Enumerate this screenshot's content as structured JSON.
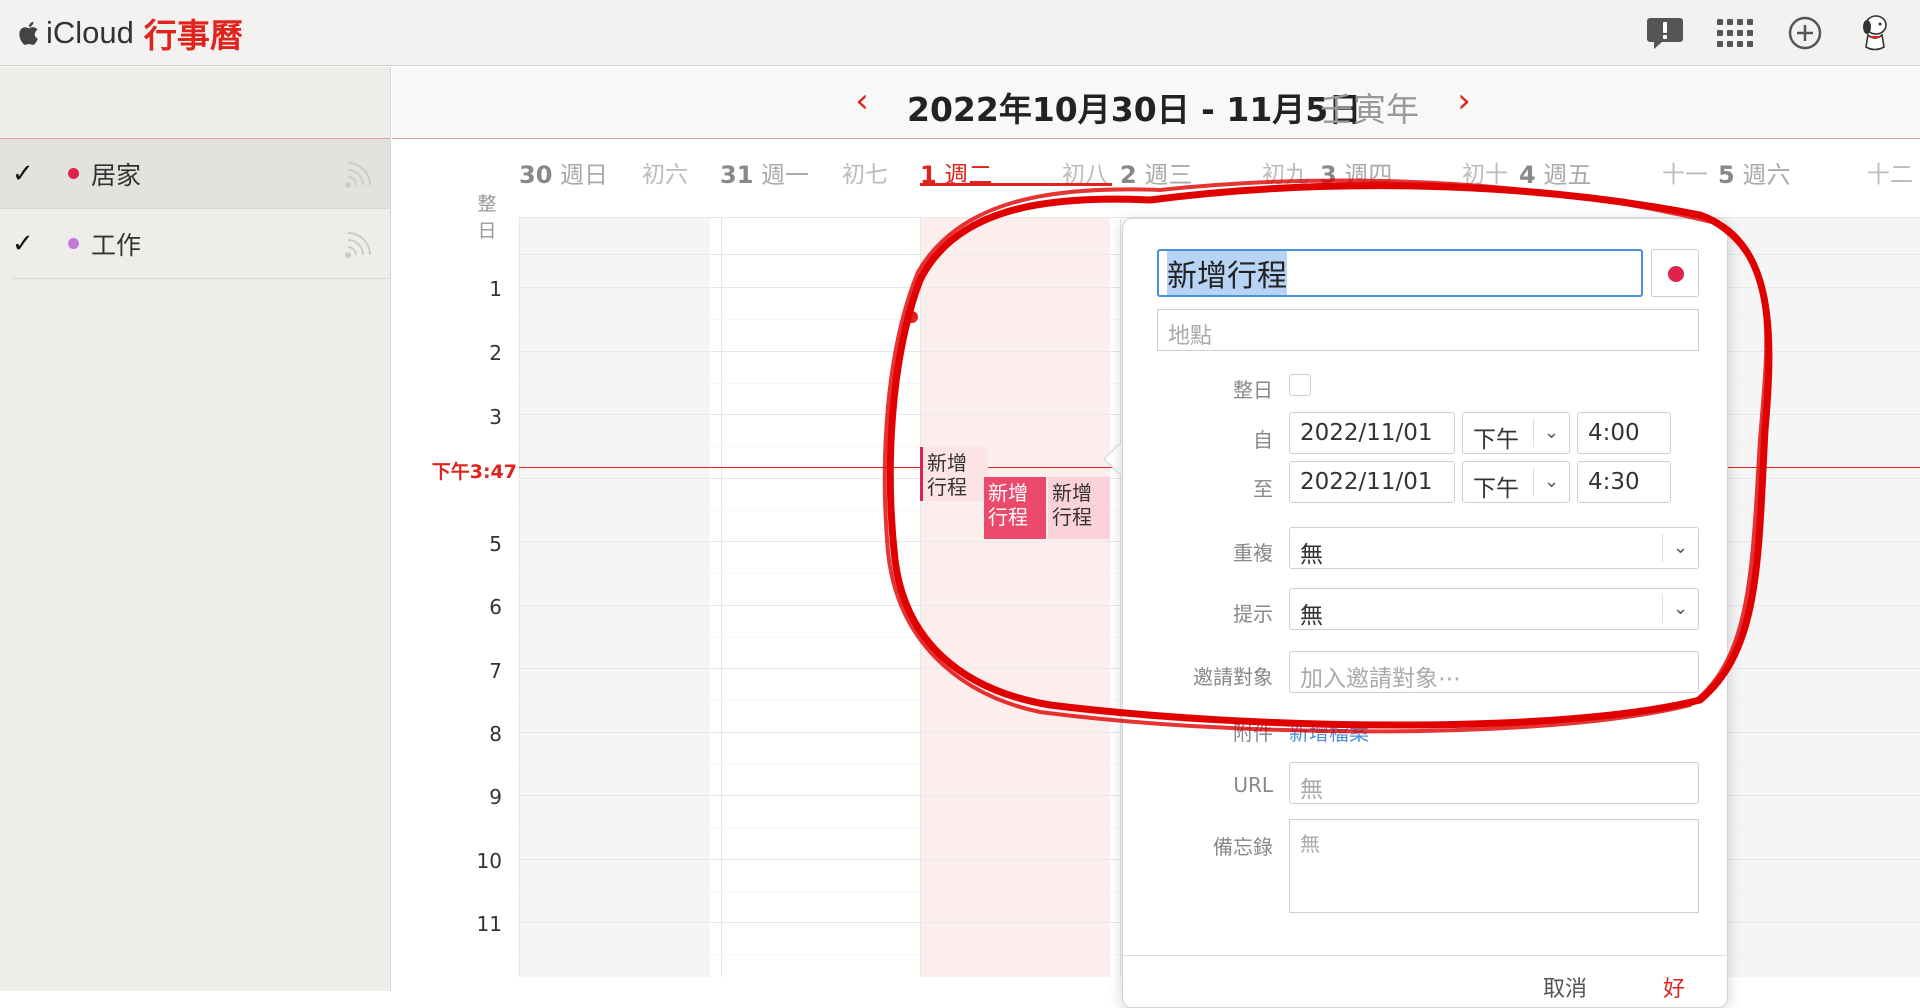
{
  "app": {
    "brand_name": "iCloud",
    "app_name": "行事曆",
    "icons": [
      "feedback-icon",
      "apps-grid-icon",
      "add-icon",
      "avatar"
    ]
  },
  "sidebar": {
    "calendars": [
      {
        "name": "居家",
        "checked": true,
        "color": "#e0234a"
      },
      {
        "name": "工作",
        "checked": true,
        "color": "#c57ad8"
      }
    ]
  },
  "header": {
    "range": "2022年10月30日 - 11月5日",
    "lunar_year": "壬寅年",
    "prev": "‹",
    "next": "›"
  },
  "days": [
    {
      "num": "30",
      "weekday": "週日",
      "lunar": "初六"
    },
    {
      "num": "31",
      "weekday": "週一",
      "lunar": "初七"
    },
    {
      "num": "1",
      "weekday": "週二",
      "lunar": "初八",
      "today": true
    },
    {
      "num": "2",
      "weekday": "週三",
      "lunar": "初九"
    },
    {
      "num": "3",
      "weekday": "週四",
      "lunar": "初十"
    },
    {
      "num": "4",
      "weekday": "週五",
      "lunar": "十一"
    },
    {
      "num": "5",
      "weekday": "週六",
      "lunar": "十二"
    }
  ],
  "allday_label": "整日",
  "hours": [
    "1",
    "2",
    "3",
    "5",
    "6",
    "7",
    "8",
    "9",
    "10",
    "11"
  ],
  "now_label": "下午3:47",
  "events": [
    {
      "label": "新增\n行程",
      "line1": "新增",
      "line2": "行程"
    },
    {
      "line1": "新增",
      "line2": "行程"
    },
    {
      "line1": "新增",
      "line2": "行程"
    }
  ],
  "popover": {
    "title_value": "新增行程",
    "location_placeholder": "地點",
    "allday_label": "整日",
    "from_label": "自",
    "to_label": "至",
    "from_date": "2022/11/01",
    "from_ampm": "下午",
    "from_time": "4:00",
    "to_date": "2022/11/01",
    "to_ampm": "下午",
    "to_time": "4:30",
    "repeat_label": "重複",
    "repeat_value": "無",
    "alert_label": "提示",
    "alert_value": "無",
    "invitees_label": "邀請對象",
    "invitees_placeholder": "加入邀請對象⋯",
    "attachment_label": "附件",
    "attachment_link": "新增檔案",
    "url_label": "URL",
    "url_placeholder": "無",
    "notes_label": "備忘錄",
    "notes_placeholder": "無",
    "cancel_label": "取消",
    "add_label": "好"
  },
  "colors": {
    "accent": "#e0231c",
    "selection_blue": "#4a8fe0",
    "annotation": "#e00000"
  }
}
